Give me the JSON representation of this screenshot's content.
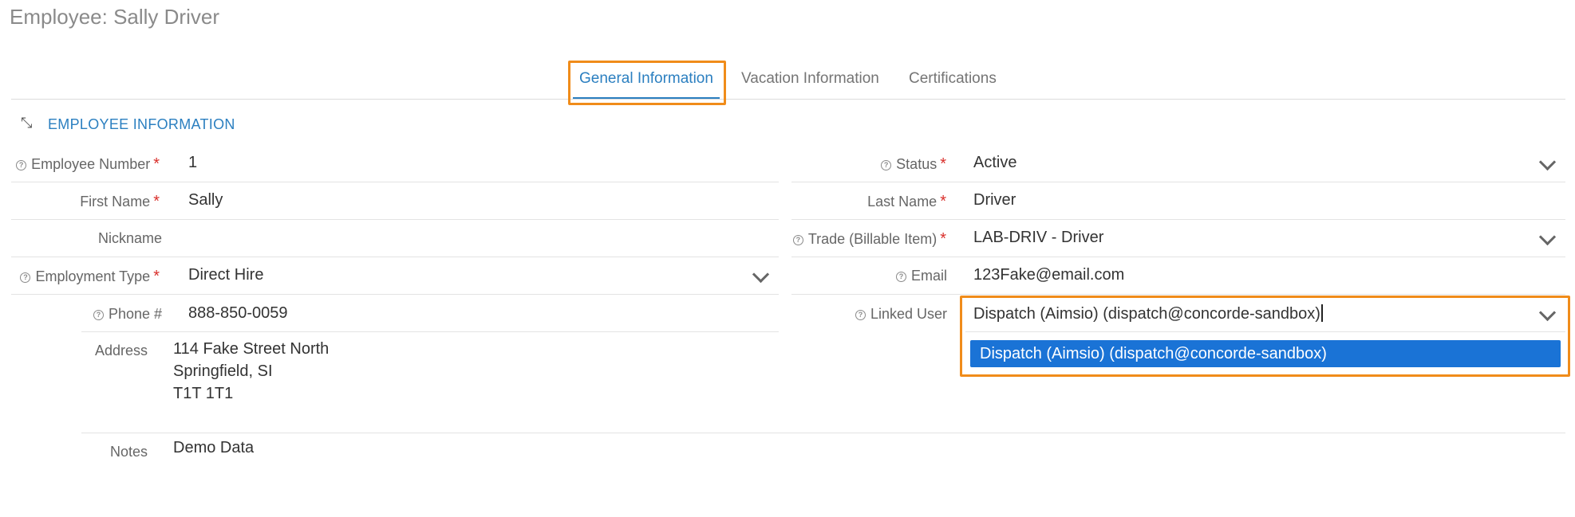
{
  "page": {
    "title": "Employee: Sally Driver"
  },
  "tabs": [
    {
      "label": "General Information"
    },
    {
      "label": "Vacation Information"
    },
    {
      "label": "Certifications"
    }
  ],
  "section": {
    "title": "EMPLOYEE INFORMATION"
  },
  "fields": {
    "employee_number": {
      "label": "Employee Number",
      "value": "1"
    },
    "first_name": {
      "label": "First Name",
      "value": "Sally"
    },
    "nickname": {
      "label": "Nickname",
      "value": ""
    },
    "employment_type": {
      "label": "Employment Type",
      "value": "Direct Hire"
    },
    "phone": {
      "label": "Phone #",
      "value": "888-850-0059"
    },
    "address": {
      "label": "Address",
      "line1": "114 Fake Street North",
      "line2": "Springfield, SI",
      "line3": "T1T 1T1"
    },
    "notes": {
      "label": "Notes",
      "value": "Demo Data"
    },
    "status": {
      "label": "Status",
      "value": "Active"
    },
    "last_name": {
      "label": "Last Name",
      "value": "Driver"
    },
    "trade": {
      "label": "Trade (Billable Item)",
      "value": "LAB-DRIV - Driver"
    },
    "email": {
      "label": "Email",
      "value": "123Fake@email.com"
    },
    "linked_user": {
      "label": "Linked User",
      "value": "Dispatch (Aimsio) (dispatch@concorde-sandbox)",
      "options": [
        "Dispatch (Aimsio) (dispatch@concorde-sandbox)"
      ]
    }
  },
  "required_mark": "*",
  "icons": {
    "help": "help-circle-icon",
    "collapse": "collapse-arrows-icon",
    "dropdown": "chevron-down-icon"
  },
  "colors": {
    "accent": "#2b7fc0",
    "highlight": "#f08c1a",
    "required": "#d9302c",
    "selected_option": "#1a73d6"
  }
}
